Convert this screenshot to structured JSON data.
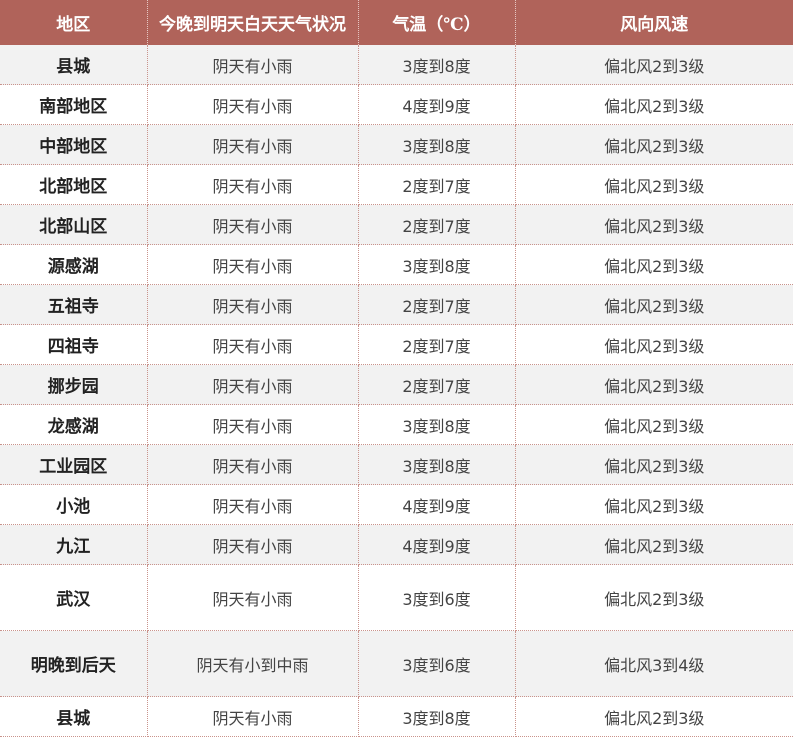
{
  "header": {
    "col_region": "地区",
    "col_weather": "今晚到明天白天天气状况",
    "col_temp": "气温（℃）",
    "col_wind": "风向风速"
  },
  "rows": [
    {
      "region": "县城",
      "weather": "阴天有小雨",
      "temp": "3度到8度",
      "wind": "偏北风2到3级"
    },
    {
      "region": "南部地区",
      "weather": "阴天有小雨",
      "temp": "4度到9度",
      "wind": "偏北风2到3级"
    },
    {
      "region": "中部地区",
      "weather": "阴天有小雨",
      "temp": "3度到8度",
      "wind": "偏北风2到3级"
    },
    {
      "region": "北部地区",
      "weather": "阴天有小雨",
      "temp": "2度到7度",
      "wind": "偏北风2到3级"
    },
    {
      "region": "北部山区",
      "weather": "阴天有小雨",
      "temp": "2度到7度",
      "wind": "偏北风2到3级"
    },
    {
      "region": "源感湖",
      "weather": "阴天有小雨",
      "temp": "3度到8度",
      "wind": "偏北风2到3级"
    },
    {
      "region": "五祖寺",
      "weather": "阴天有小雨",
      "temp": "2度到7度",
      "wind": "偏北风2到3级"
    },
    {
      "region": "四祖寺",
      "weather": "阴天有小雨",
      "temp": "2度到7度",
      "wind": "偏北风2到3级"
    },
    {
      "region": "挪步园",
      "weather": "阴天有小雨",
      "temp": "2度到7度",
      "wind": "偏北风2到3级"
    },
    {
      "region": "龙感湖",
      "weather": "阴天有小雨",
      "temp": "3度到8度",
      "wind": "偏北风2到3级"
    },
    {
      "region": "工业园区",
      "weather": "阴天有小雨",
      "temp": "3度到8度",
      "wind": "偏北风2到3级"
    },
    {
      "region": "小池",
      "weather": "阴天有小雨",
      "temp": "4度到9度",
      "wind": "偏北风2到3级"
    },
    {
      "region": "九江",
      "weather": "阴天有小雨",
      "temp": "4度到9度",
      "wind": "偏北风2到3级"
    },
    {
      "region": "武汉",
      "weather": "阴天有小雨",
      "temp": "3度到6度",
      "wind": "偏北风2到3级"
    },
    {
      "region": "明晚到后天",
      "weather": "阴天有小到中雨",
      "temp": "3度到6度",
      "wind": "偏北风3到4级"
    },
    {
      "region": "县城",
      "weather": "阴天有小雨",
      "temp": "3度到8度",
      "wind": "偏北风2到3级"
    }
  ],
  "colors": {
    "header_bg": "#b0635a",
    "header_text": "#ffffff",
    "row_alt_bg": "#f2f2f2",
    "border": "#c9938c"
  }
}
